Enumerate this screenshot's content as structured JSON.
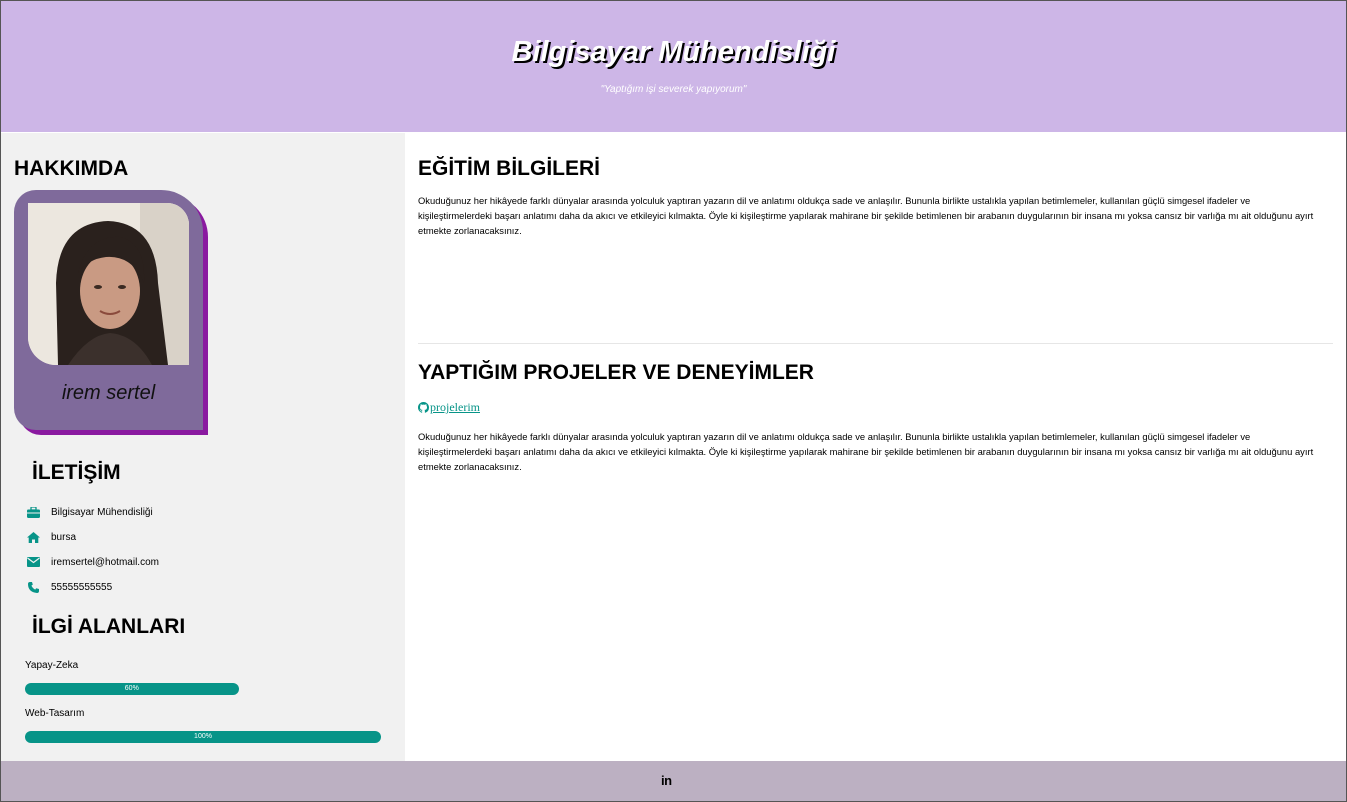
{
  "header": {
    "title": "Bilgisayar Mühendisliği",
    "subtitle": "\"Yaptığım işi severek yapıyorum\""
  },
  "sidebar": {
    "about_heading": "HAKKIMDA",
    "profile": {
      "name": "irem sertel",
      "photo_icon": "profile-photo"
    },
    "contact_heading": "İLETİŞİM",
    "contact": [
      {
        "icon": "briefcase-icon",
        "text": "Bilgisayar Mühendisliği"
      },
      {
        "icon": "home-icon",
        "text": "bursa"
      },
      {
        "icon": "envelope-icon",
        "text": "iremsertel@hotmail.com"
      },
      {
        "icon": "phone-icon",
        "text": "55555555555"
      }
    ],
    "interests_heading": "İLGİ ALANLARI",
    "skills": [
      {
        "label": "Yapay-Zeka",
        "percent_text": "60%",
        "level": 0.6
      },
      {
        "label": "Web-Tasarım",
        "percent_text": "100%",
        "level": 1.0
      }
    ]
  },
  "main": {
    "education_heading": "EĞİTİM BİLGİLERİ",
    "education_text": "Okuduğunuz her hikâyede farklı dünyalar arasında yolculuk yaptıran yazarın dil ve anlatımı oldukça sade ve anlaşılır. Bununla birlikte ustalıkla yapılan betimlemeler, kullanılan güçlü simgesel ifadeler ve kişileştirmelerdeki başarı anlatımı daha da akıcı ve etkileyici kılmakta. Öyle ki kişileştirme yapılarak mahirane bir şekilde betimlenen bir arabanın duygularının bir insana mı yoksa cansız bir varlığa mı ait olduğunu ayırt etmekte zorlanacaksınız.",
    "projects_heading": "YAPTIĞIM PROJELER VE DENEYİMLER",
    "projects_link": "projelerim",
    "projects_text": "Okuduğunuz her hikâyede farklı dünyalar arasında yolculuk yaptıran yazarın dil ve anlatımı oldukça sade ve anlaşılır. Bununla birlikte ustalıkla yapılan betimlemeler, kullanılan güçlü simgesel ifadeler ve kişileştirmelerdeki başarı anlatımı daha da akıcı ve etkileyici kılmakta. Öyle ki kişileştirme yapılarak mahirane bir şekilde betimlenen bir arabanın duygularının bir insana mı yoksa cansız bir varlığa mı ait olduğunu ayırt etmekte zorlanacaksınız."
  },
  "footer": {
    "linkedin_label": "in"
  },
  "colors": {
    "header_bg": "#cdb6e7",
    "accent": "#079488",
    "card_bg": "#7f6a9b",
    "card_shadow": "#8a1aa0",
    "footer_bg": "#bcb0c2"
  }
}
